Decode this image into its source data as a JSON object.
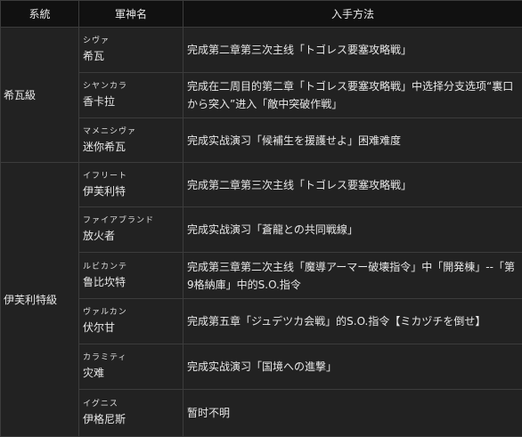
{
  "headers": {
    "system": "系統",
    "name": "軍神名",
    "method": "入手方法"
  },
  "groups": [
    {
      "system": "希瓦級",
      "rows": [
        {
          "kana": "シヴァ",
          "name": "希瓦",
          "method": "完成第二章第三次主线「トゴレス要塞攻略戦」"
        },
        {
          "kana": "シヤンカラ",
          "name": "香卡拉",
          "method": "完成在二周目的第二章「トゴレス要塞攻略戦」中选择分支选项“裏口から突入”进入「敵中突破作戦」"
        },
        {
          "kana": "マメニシヴァ",
          "name": "迷你希瓦",
          "method": "完成实战演习「候補生を援護せよ」困难难度"
        }
      ]
    },
    {
      "system": "伊芙利特級",
      "rows": [
        {
          "kana": "イフリート",
          "name": "伊芙利特",
          "method": "完成第二章第三次主线「トゴレス要塞攻略戦」"
        },
        {
          "kana": "ファイアブランド",
          "name": "放火者",
          "method": "完成实战演习「蒼龍との共同戦線」"
        },
        {
          "kana": "ルビカンテ",
          "name": "鲁比坎特",
          "method": "完成第三章第二次主线「魔導アーマー破壊指令」中「開発棟」--「第9格納庫」中的S.O.指令"
        },
        {
          "kana": "ヴァルカン",
          "name": "伏尔甘",
          "method": "完成第五章「ジュデツカ会戦」的S.O.指令【ミカヅチを倒せ】"
        },
        {
          "kana": "カラミティ",
          "name": "灾难",
          "method": "完成实战演习「国境への進撃」"
        },
        {
          "kana": "イグニス",
          "name": "伊格尼斯",
          "method": "暂时不明"
        }
      ]
    }
  ]
}
